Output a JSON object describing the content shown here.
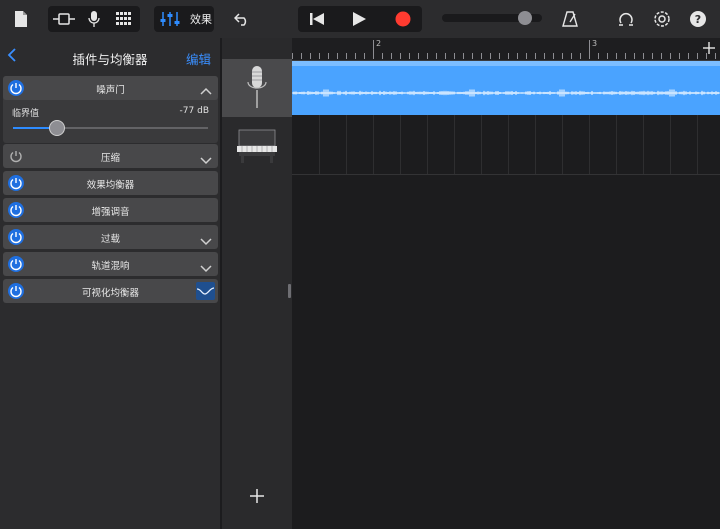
{
  "toolbar": {
    "icons": [
      "document-icon",
      "browser-view-icon",
      "microphone-icon",
      "grid-icon",
      "mixer-icon",
      "undo-icon",
      "rewind-icon",
      "play-icon",
      "record-icon",
      "volume-knob-icon",
      "metronome-icon",
      "loop-icon",
      "settings-icon",
      "help-icon"
    ],
    "fx_label": "效果",
    "record_color": "#ff3b30",
    "accent": "#2e8cff"
  },
  "ruler": {
    "marks": [
      "2",
      "3"
    ]
  },
  "plugins_panel": {
    "title": "插件与均衡器",
    "edit_label": "编辑",
    "noise_gate": {
      "name": "噪声门",
      "threshold_label": "临界值",
      "threshold_value": "-77 dB",
      "threshold_level": 0.22
    },
    "items": [
      {
        "name": "压缩",
        "enabled": false,
        "expandable": true
      },
      {
        "name": "效果均衡器",
        "enabled": true,
        "expandable": false
      },
      {
        "name": "增强调音",
        "enabled": true,
        "expandable": false
      },
      {
        "name": "过载",
        "enabled": true,
        "expandable": true
      },
      {
        "name": "轨道混响",
        "enabled": true,
        "expandable": true
      },
      {
        "name": "可视化均衡器",
        "enabled": true,
        "expandable": false
      }
    ]
  },
  "tracks": [
    {
      "icon": "microphone-track-icon",
      "selected": true
    },
    {
      "icon": "piano-track-icon",
      "selected": false
    }
  ],
  "region_color": "#4aa3ff"
}
